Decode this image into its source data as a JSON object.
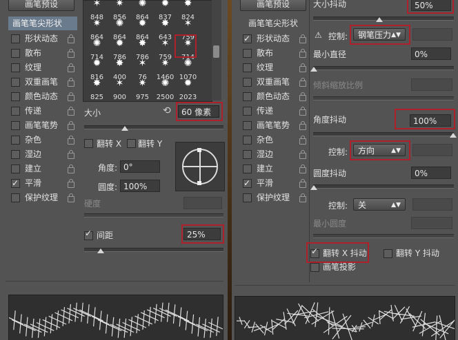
{
  "left": {
    "preset_button": "画笔预设",
    "sidebar_header": "画笔笔尖形状",
    "sidebar_items": [
      {
        "label": "形状动态",
        "checked": false
      },
      {
        "label": "散布",
        "checked": false
      },
      {
        "label": "纹理",
        "checked": false
      },
      {
        "label": "双重画笔",
        "checked": false
      },
      {
        "label": "颜色动态",
        "checked": false
      },
      {
        "label": "传递",
        "checked": false
      },
      {
        "label": "画笔笔势",
        "checked": false
      },
      {
        "label": "杂色",
        "checked": false
      },
      {
        "label": "湿边",
        "checked": false
      },
      {
        "label": "建立",
        "checked": false
      },
      {
        "label": "平滑",
        "checked": true
      },
      {
        "label": "保护纹理",
        "checked": false
      }
    ],
    "brush_rows": [
      [
        "848",
        "856",
        "864",
        "837",
        "824"
      ],
      [
        "864",
        "864",
        "864",
        "643",
        "759"
      ],
      [
        "714",
        "786",
        "786",
        "759",
        "714"
      ],
      [
        "816",
        "400",
        "76",
        "1460",
        "1070"
      ],
      [
        "825",
        "900",
        "975",
        "2500",
        "2023"
      ]
    ],
    "size_label": "大小",
    "size_value": "60 像素",
    "flip_x": "翻转 X",
    "flip_y": "翻转 Y",
    "angle_label": "角度:",
    "angle_value": "0°",
    "roundness_label": "圆度:",
    "roundness_value": "100%",
    "hardness_label": "硬度",
    "spacing_label": "间距",
    "spacing_value": "25%"
  },
  "right": {
    "preset_button": "画笔预设",
    "sidebar_header": "画笔笔尖形状",
    "sidebar_items": [
      {
        "label": "形状动态",
        "checked": true
      },
      {
        "label": "散布",
        "checked": false
      },
      {
        "label": "纹理",
        "checked": false
      },
      {
        "label": "双重画笔",
        "checked": false
      },
      {
        "label": "颜色动态",
        "checked": false
      },
      {
        "label": "传递",
        "checked": false
      },
      {
        "label": "画笔笔势",
        "checked": false
      },
      {
        "label": "杂色",
        "checked": false
      },
      {
        "label": "湿边",
        "checked": false
      },
      {
        "label": "建立",
        "checked": false
      },
      {
        "label": "平滑",
        "checked": true
      },
      {
        "label": "保护纹理",
        "checked": false
      }
    ],
    "size_jitter_label": "大小抖动",
    "size_jitter_value": "50%",
    "control1_label": "控制:",
    "control1_value": "钢笔压力",
    "min_diameter_label": "最小直径",
    "min_diameter_value": "0%",
    "tilt_scale_label": "倾斜缩放比例",
    "angle_jitter_label": "角度抖动",
    "angle_jitter_value": "100%",
    "control2_label": "控制:",
    "control2_value": "方向",
    "roundness_jitter_label": "圆度抖动",
    "roundness_jitter_value": "0%",
    "control3_label": "控制:",
    "control3_value": "关",
    "min_roundness_label": "最小圆度",
    "flip_x_jitter": "翻转 X 抖动",
    "flip_y_jitter": "翻转 Y 抖动",
    "brush_projection": "画笔投影"
  }
}
